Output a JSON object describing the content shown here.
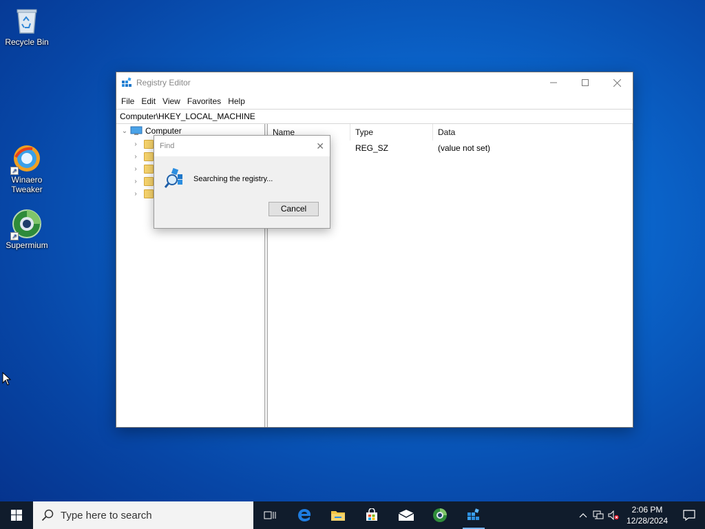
{
  "desktop": {
    "icons": [
      {
        "label": "Recycle Bin",
        "icon": "recycle-bin-icon"
      },
      {
        "label": "Winaero Tweaker",
        "icon": "winaero-tweaker-icon"
      },
      {
        "label": "Supermium",
        "icon": "supermium-icon"
      }
    ]
  },
  "regedit": {
    "title": "Registry Editor",
    "menu": [
      "File",
      "Edit",
      "View",
      "Favorites",
      "Help"
    ],
    "address": "Computer\\HKEY_LOCAL_MACHINE",
    "tree": {
      "root_label": "Computer",
      "child_count": 5
    },
    "columns": [
      "Name",
      "Type",
      "Data"
    ],
    "rows": [
      {
        "name": "",
        "type": "REG_SZ",
        "data": "(value not set)"
      }
    ]
  },
  "find_dialog": {
    "title": "Find",
    "message": "Searching the registry...",
    "cancel_label": "Cancel"
  },
  "taskbar": {
    "search_placeholder": "Type here to search",
    "apps": [
      "task-view-icon",
      "edge-icon",
      "file-explorer-icon",
      "store-icon",
      "mail-icon",
      "supermium-icon",
      "registry-editor-icon"
    ],
    "active_app": "registry-editor-icon",
    "time": "2:06 PM",
    "date": "12/28/2024"
  },
  "colors": {
    "desktop_blue": "#0a63c9",
    "taskbar": "#101c2c",
    "folder": "#f7d46d"
  }
}
